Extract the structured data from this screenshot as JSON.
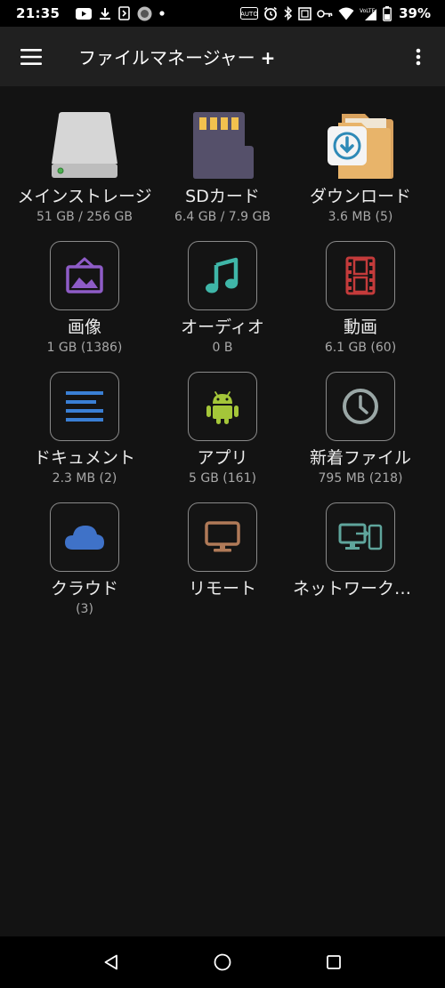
{
  "status_bar": {
    "time": "21:35",
    "battery": "39%",
    "icons_left": [
      "youtube-icon",
      "download-icon",
      "nfc-icon",
      "chat-icon",
      "dot-icon"
    ],
    "icons_right": [
      "auto-icon",
      "alarm-icon",
      "bluetooth-icon",
      "screenshot-icon",
      "key-icon",
      "wifi-icon",
      "lte-signal-icon",
      "battery-icon"
    ]
  },
  "app_bar": {
    "title": "ファイルマネージャー",
    "plus": "+"
  },
  "tiles": [
    {
      "label": "メインストレージ",
      "sub": "51 GB / 256 GB",
      "icon": "internal-storage-icon"
    },
    {
      "label": "SDカード",
      "sub": "6.4 GB / 7.9 GB",
      "icon": "sd-card-icon"
    },
    {
      "label": "ダウンロード",
      "sub": "3.6 MB (5)",
      "icon": "download-folder-icon"
    },
    {
      "label": "画像",
      "sub": "1 GB (1386)",
      "icon": "image-icon",
      "color": "#8e5cc7"
    },
    {
      "label": "オーディオ",
      "sub": "0 B",
      "icon": "music-icon",
      "color": "#3fb6a8"
    },
    {
      "label": "動画",
      "sub": "6.1 GB (60)",
      "icon": "video-icon",
      "color": "#c43b3b"
    },
    {
      "label": "ドキュメント",
      "sub": "2.3 MB (2)",
      "icon": "document-icon",
      "color": "#3a7fd4"
    },
    {
      "label": "アプリ",
      "sub": "5 GB (161)",
      "icon": "android-icon",
      "color": "#a4c639"
    },
    {
      "label": "新着ファイル",
      "sub": "795 MB (218)",
      "icon": "clock-icon",
      "color": "#9aa7a6"
    },
    {
      "label": "クラウド",
      "sub": "(3)",
      "icon": "cloud-icon",
      "color": "#3f72c8"
    },
    {
      "label": "リモート",
      "sub": "",
      "icon": "remote-monitor-icon",
      "color": "#b07a58"
    },
    {
      "label": "ネットワークからアクセス",
      "sub": "",
      "icon": "network-access-icon",
      "color": "#5fa59c"
    }
  ],
  "nav_bar": {
    "icons": [
      "back-icon",
      "home-icon",
      "recents-icon"
    ]
  }
}
